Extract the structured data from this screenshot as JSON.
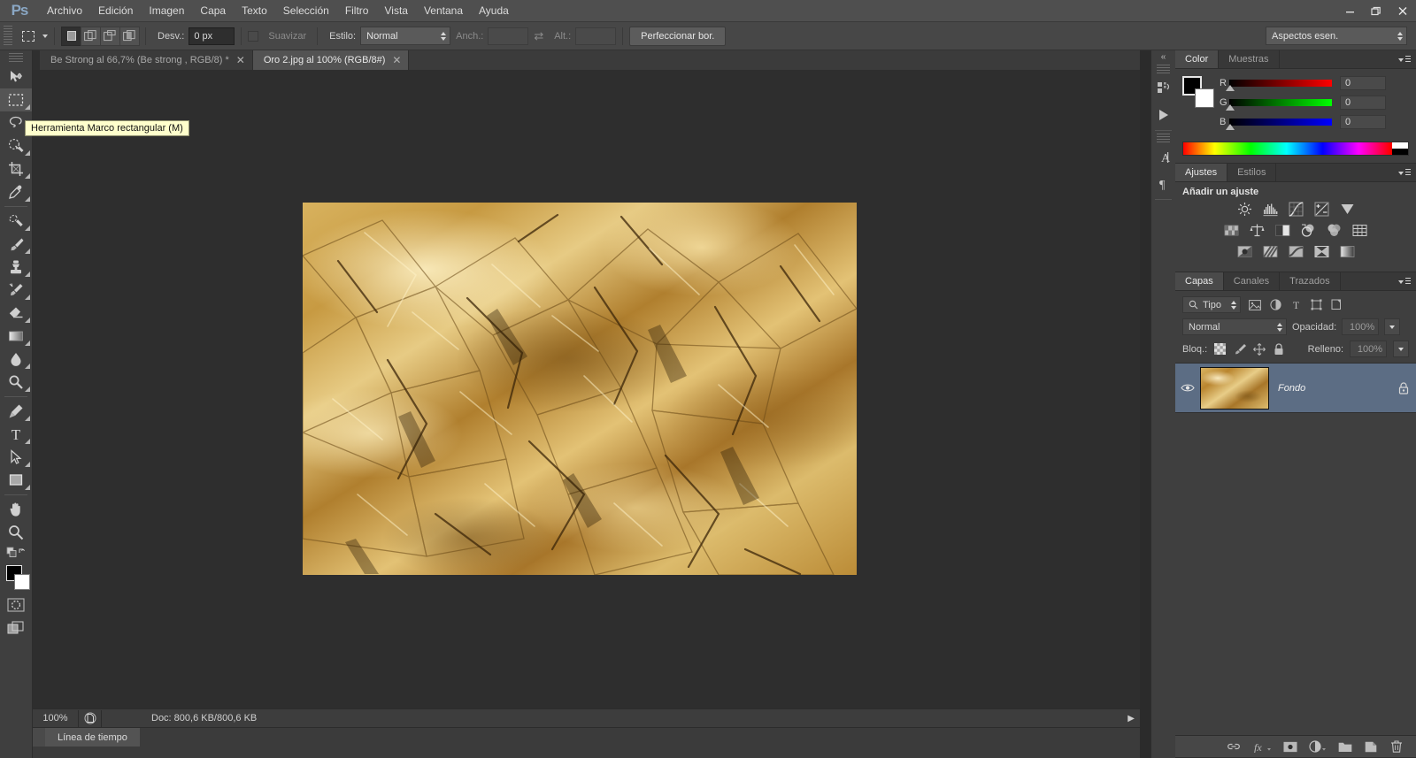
{
  "app": {
    "logo": "Ps"
  },
  "menubar": {
    "items": [
      "Archivo",
      "Edición",
      "Imagen",
      "Capa",
      "Texto",
      "Selección",
      "Filtro",
      "Vista",
      "Ventana",
      "Ayuda"
    ]
  },
  "window_controls": {
    "minimize": "—",
    "restore": "❐",
    "close": "✕"
  },
  "options_bar": {
    "tool_icon": "rectangular-marquee-icon",
    "bool_modes": [
      "new-selection",
      "add-to-selection",
      "subtract-from-selection",
      "intersect-selection"
    ],
    "feather_label": "Desv.:",
    "feather_value": "0 px",
    "antialias_label": "Suavizar",
    "style_label": "Estilo:",
    "style_value": "Normal",
    "width_label": "Anch.:",
    "width_value": "",
    "swap_icon": "swap-dimensions-icon",
    "height_label": "Alt.:",
    "height_value": "",
    "refine_edge": "Perfeccionar bor.",
    "workspace": "Aspectos esen."
  },
  "tabs": [
    {
      "label": "Be Strong al 66,7%  (Be strong  , RGB/8) *",
      "active": false,
      "close": "✕"
    },
    {
      "label": "Oro 2.jpg al 100%  (RGB/8#)",
      "active": true,
      "close": "✕"
    }
  ],
  "tooltip": {
    "text": "Herramienta Marco rectangular (M)"
  },
  "toolbar": {
    "tools": [
      {
        "name": "move-tool",
        "active": false
      },
      {
        "name": "rectangular-marquee-tool",
        "active": true
      },
      {
        "name": "lasso-tool",
        "active": false
      },
      {
        "name": "quick-selection-tool",
        "active": false
      },
      {
        "name": "crop-tool",
        "active": false
      },
      {
        "name": "eyedropper-tool",
        "active": false
      },
      {
        "name": "healing-brush-tool",
        "active": false
      },
      {
        "name": "brush-tool",
        "active": false
      },
      {
        "name": "clone-stamp-tool",
        "active": false
      },
      {
        "name": "history-brush-tool",
        "active": false
      },
      {
        "name": "eraser-tool",
        "active": false
      },
      {
        "name": "gradient-tool",
        "active": false
      },
      {
        "name": "blur-tool",
        "active": false
      },
      {
        "name": "dodge-tool",
        "active": false
      },
      {
        "name": "pen-tool",
        "active": false
      },
      {
        "name": "type-tool",
        "active": false
      },
      {
        "name": "path-selection-tool",
        "active": false
      },
      {
        "name": "rectangle-tool",
        "active": false
      },
      {
        "name": "hand-tool",
        "active": false
      },
      {
        "name": "zoom-tool",
        "active": false
      }
    ],
    "foreground_color": "#000000",
    "background_color": "#ffffff",
    "quick_mask": "quick-mask-icon",
    "screen_mode": "screen-mode-icon"
  },
  "canvas": {
    "document": "Oro 2.jpg",
    "selection": "full-canvas-marching-ants",
    "image_description": "crumpled gold foil texture"
  },
  "status_bar": {
    "zoom": "100%",
    "doc_icon": "document-profile-icon",
    "doc_info": "Doc: 800,6 KB/800,6 KB",
    "arrow": "▶"
  },
  "timeline": {
    "tab_label": "Línea de tiempo"
  },
  "icon_dock": {
    "collapse": "«",
    "icons": [
      "mini-bridge-icon",
      "actions-play-icon",
      "character-panel-icon",
      "paragraph-panel-icon"
    ]
  },
  "color_panel": {
    "tabs": [
      {
        "label": "Color",
        "active": true
      },
      {
        "label": "Muestras",
        "active": false
      }
    ],
    "menu_icon": "panel-menu-icon",
    "foreground": "#000000",
    "background": "#ffffff",
    "channels": [
      {
        "label": "R",
        "value": "0"
      },
      {
        "label": "G",
        "value": "0"
      },
      {
        "label": "B",
        "value": "0"
      }
    ],
    "spectrum": "color-ramp"
  },
  "adjustments_panel": {
    "tabs": [
      {
        "label": "Ajustes",
        "active": true
      },
      {
        "label": "Estilos",
        "active": false
      }
    ],
    "menu_icon": "panel-menu-icon",
    "title": "Añadir un ajuste",
    "rows": [
      [
        "brightness-contrast-icon",
        "levels-icon",
        "curves-icon",
        "exposure-icon",
        "vibrance-icon"
      ],
      [
        "hue-saturation-icon",
        "color-balance-icon",
        "black-white-icon",
        "photo-filter-icon",
        "channel-mixer-icon",
        "color-lookup-icon"
      ],
      [
        "invert-icon",
        "posterize-icon",
        "threshold-icon",
        "selective-color-icon",
        "gradient-map-icon"
      ]
    ]
  },
  "layers_panel": {
    "tabs": [
      {
        "label": "Capas",
        "active": true
      },
      {
        "label": "Canales",
        "active": false
      },
      {
        "label": "Trazados",
        "active": false
      }
    ],
    "menu_icon": "panel-menu-icon",
    "filter": {
      "search_icon": "search-icon",
      "value": "Tipo"
    },
    "filter_icons": [
      "filter-pixel-icon",
      "filter-adjustment-icon",
      "filter-type-icon",
      "filter-shape-icon",
      "filter-smart-object-icon"
    ],
    "blend_mode": "Normal",
    "opacity_label": "Opacidad:",
    "opacity_value": "100%",
    "lock_label": "Bloq.:",
    "lock_icons": [
      "lock-transparency-icon",
      "lock-image-icon",
      "lock-position-icon",
      "lock-all-icon"
    ],
    "fill_label": "Relleno:",
    "fill_value": "100%",
    "layers": [
      {
        "name": "Fondo",
        "visible": true,
        "locked": true,
        "selected": true,
        "thumbnail": "gold-foil-thumb"
      }
    ],
    "footer_icons": [
      "link-layers-icon",
      "layer-styles-icon",
      "add-mask-icon",
      "new-adjustment-icon",
      "new-group-icon",
      "new-layer-icon",
      "delete-layer-icon"
    ],
    "footer_fx_label": "fx"
  },
  "colors": {
    "chrome": "#3f3f3f",
    "panel_header": "#383838",
    "canvas_bg": "#2e2e2e",
    "menubar_bg": "#4f4f4f",
    "layer_selected": "#5c6d84",
    "accent_logo": "#8aa7c4",
    "tooltip_bg": "#ffffcc"
  }
}
